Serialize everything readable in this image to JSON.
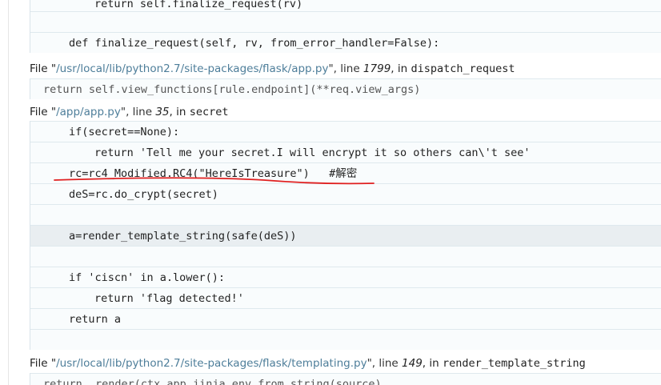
{
  "frames": [
    {
      "lines": [
        {
          "text": "return self.finalize_request(rv)",
          "indent": 2
        },
        {
          "text": "",
          "indent": 0
        },
        {
          "text": "def finalize_request(self, rv, from_error_handler=False):",
          "indent": 1
        }
      ]
    },
    {
      "file": {
        "prefix": "File \"",
        "path": "/usr/local/lib/python2.7/site-packages/flask/app.py",
        "line_label": "\", line ",
        "line_no": "1799",
        "in_label": ", in ",
        "func": "dispatch_request"
      },
      "lines": [
        {
          "text": "return self.view_functions[rule.endpoint](**req.view_args)"
        }
      ]
    },
    {
      "file": {
        "prefix": "File \"",
        "path": "/app/app.py",
        "line_label": "\", line ",
        "line_no": "35",
        "in_label": ", in ",
        "func": "secret"
      },
      "lines": [
        {
          "text": "if(secret==None):"
        },
        {
          "text": "return 'Tell me your secret.I will encrypt it so others can\\'t see'"
        },
        {
          "text": "rc=rc4_Modified.RC4(\"HereIsTreasure\")   #解密"
        },
        {
          "text": "deS=rc.do_crypt(secret)"
        },
        {
          "text": ""
        },
        {
          "text": "a=render_template_string(safe(deS))"
        },
        {
          "text": ""
        },
        {
          "text": "if 'ciscn' in a.lower():"
        },
        {
          "text": "return 'flag detected!'"
        },
        {
          "text": "return a"
        },
        {
          "text": ""
        }
      ]
    },
    {
      "file": {
        "prefix": "File \"",
        "path": "/usr/local/lib/python2.7/site-packages/flask/templating.py",
        "line_label": "\", line ",
        "line_no": "149",
        "in_label": ", in ",
        "func": "render_template_string"
      },
      "lines": [
        {
          "text": "return _render(ctx.app.jinja_env.from_string(source),"
        }
      ]
    }
  ],
  "annotation": {
    "color": "#e02020",
    "target_line": "rc=rc4_Modified.RC4(\"HereIsTreasure\")"
  },
  "colors": {
    "path": "#4e7e9a",
    "code_bg": "#f9fcfd",
    "highlight_bg": "#e9eef1"
  }
}
